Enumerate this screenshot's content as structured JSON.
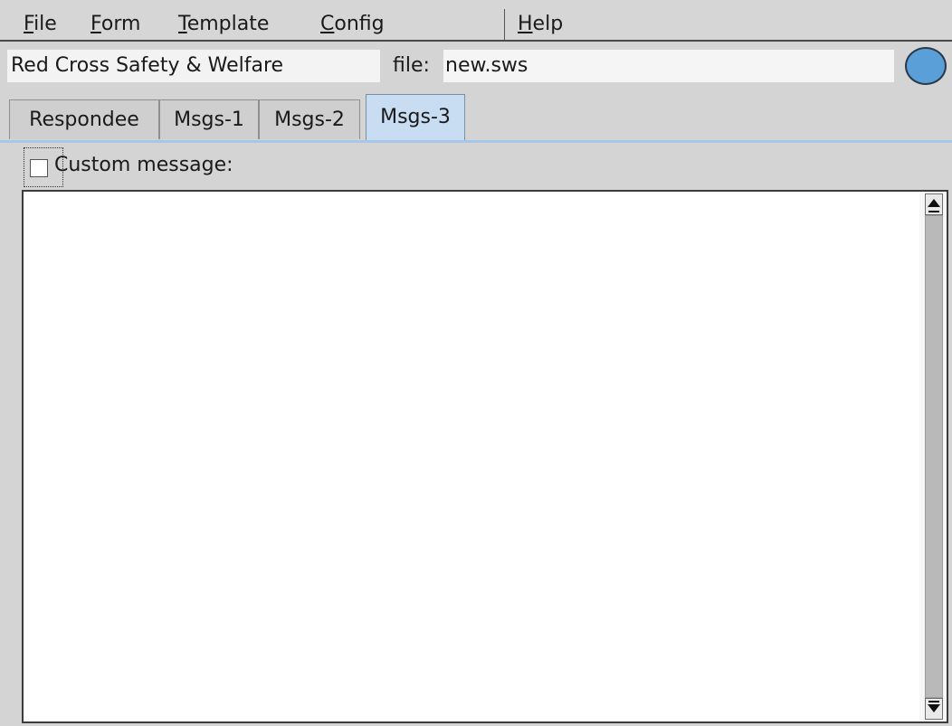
{
  "menubar": {
    "items": [
      {
        "mnemonic": "F",
        "rest": "ile"
      },
      {
        "mnemonic": "F",
        "rest": "orm"
      },
      {
        "mnemonic": "T",
        "rest": "emplate"
      },
      {
        "mnemonic": "C",
        "rest": "onfig"
      },
      {
        "mnemonic": "H",
        "rest": "elp"
      }
    ]
  },
  "header": {
    "form_title": "Red Cross Safety & Welfare",
    "file_label": "file:",
    "file_name": "new.sws",
    "status_color": "#5a9fd8"
  },
  "tabs": [
    {
      "label": "Respondee",
      "active": false
    },
    {
      "label": "Msgs-1",
      "active": false
    },
    {
      "label": "Msgs-2",
      "active": false
    },
    {
      "label": "Msgs-3",
      "active": true
    }
  ],
  "panel": {
    "custom_message_label": "Custom message:",
    "custom_message_checked": false,
    "message_text": ""
  }
}
